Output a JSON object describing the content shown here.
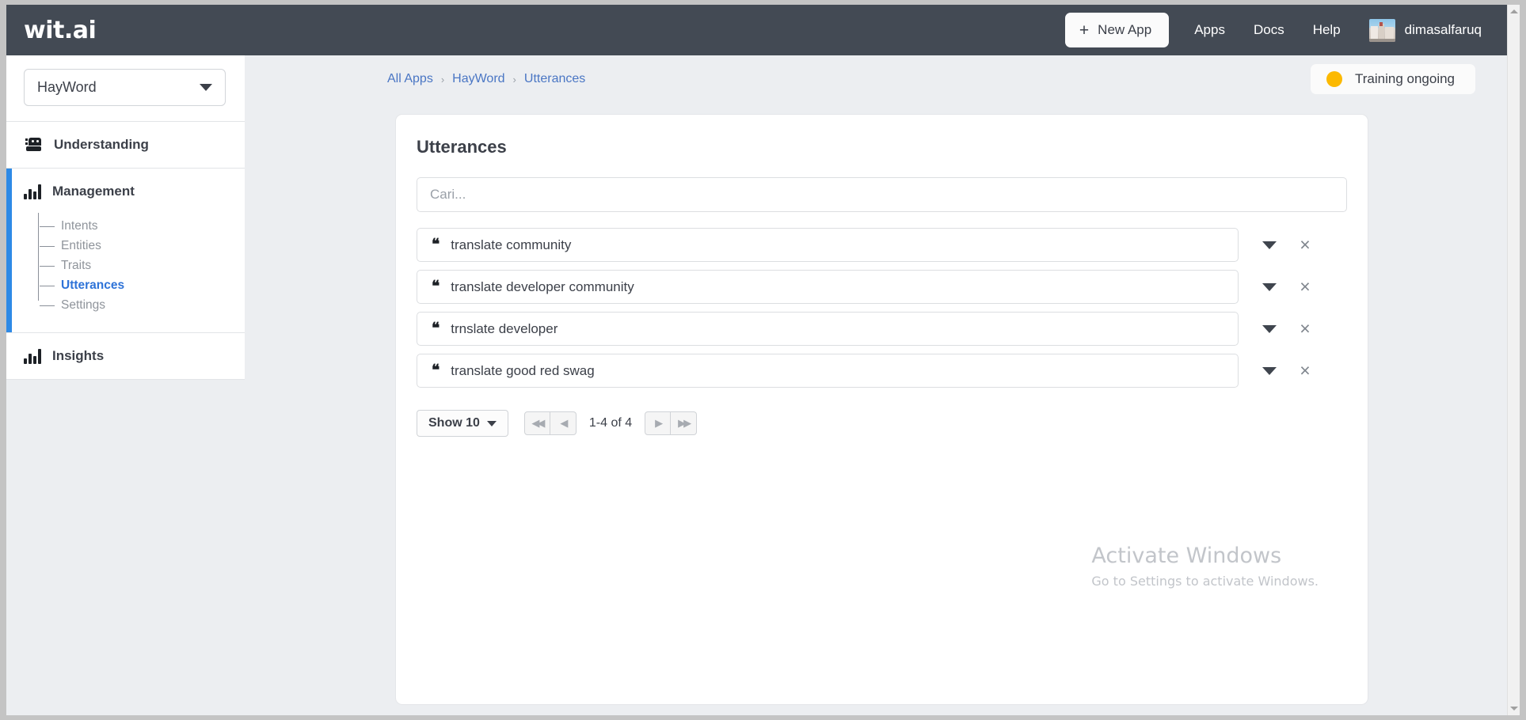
{
  "topnav": {
    "brand": "wit.ai",
    "new_app_label": "New App",
    "new_app_icon": "plus-icon",
    "links": [
      {
        "label": "Apps"
      },
      {
        "label": "Docs"
      },
      {
        "label": "Help"
      }
    ],
    "username": "dimasalfaruq",
    "background_color": "#434a54"
  },
  "sidebar": {
    "app_selector": {
      "value": "HayWord",
      "icon": "chevron-down-icon"
    },
    "sections": [
      {
        "label": "Understanding",
        "icon": "robot-icon",
        "active": false
      },
      {
        "label": "Management",
        "icon": "bar-chart-icon",
        "active": true
      },
      {
        "label": "Insights",
        "icon": "bar-chart-icon",
        "active": false
      }
    ],
    "management_items": [
      {
        "label": "Intents",
        "active": false
      },
      {
        "label": "Entities",
        "active": false
      },
      {
        "label": "Traits",
        "active": false
      },
      {
        "label": "Utterances",
        "active": true
      },
      {
        "label": "Settings",
        "active": false
      }
    ],
    "active_accent_color": "#2e8ae6"
  },
  "breadcrumb": {
    "items": [
      {
        "label": "All Apps"
      },
      {
        "label": "HayWord"
      },
      {
        "label": "Utterances"
      }
    ],
    "separator": "›",
    "link_color": "#4a76c4"
  },
  "status": {
    "label": "Training ongoing",
    "dot_color": "#fcb900",
    "dot_icon": "status-dot-icon"
  },
  "card": {
    "title": "Utterances",
    "search": {
      "value": "",
      "placeholder": "Cari..."
    },
    "utterances": [
      {
        "text": "translate community",
        "quote_icon": "quote-icon",
        "expand_icon": "chevron-down-icon",
        "delete_icon": "close-icon"
      },
      {
        "text": "translate developer community",
        "quote_icon": "quote-icon",
        "expand_icon": "chevron-down-icon",
        "delete_icon": "close-icon"
      },
      {
        "text": "trnslate developer",
        "quote_icon": "quote-icon",
        "expand_icon": "chevron-down-icon",
        "delete_icon": "close-icon"
      },
      {
        "text": "translate good red swag",
        "quote_icon": "quote-icon",
        "expand_icon": "chevron-down-icon",
        "delete_icon": "close-icon"
      }
    ],
    "quote_glyph": "❝",
    "delete_glyph": "×",
    "pagination": {
      "show_label": "Show 10",
      "range_label": "1-4 of 4",
      "first_glyph": "◀◀",
      "prev_glyph": "◀",
      "next_glyph": "▶",
      "last_glyph": "▶▶"
    }
  },
  "watermark": {
    "title": "Activate Windows",
    "subtitle": "Go to Settings to activate Windows."
  }
}
